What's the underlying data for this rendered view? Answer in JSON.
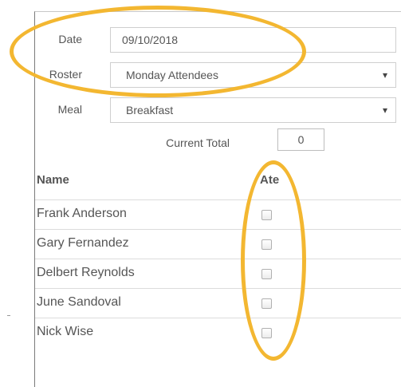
{
  "form": {
    "date_label": "Date",
    "date_value": "09/10/2018",
    "roster_label": "Roster",
    "roster_value": "Monday Attendees",
    "meal_label": "Meal",
    "meal_value": "Breakfast",
    "total_label": "Current Total",
    "total_value": "0"
  },
  "table": {
    "headers": {
      "name": "Name",
      "ate": "Ate"
    },
    "rows": [
      {
        "name": "Frank Anderson",
        "ate": false
      },
      {
        "name": "Gary Fernandez",
        "ate": false
      },
      {
        "name": "Delbert Reynolds",
        "ate": false
      },
      {
        "name": "June Sandoval",
        "ate": false
      },
      {
        "name": "Nick Wise",
        "ate": false
      }
    ]
  },
  "colors": {
    "highlight": "#f3b731"
  }
}
